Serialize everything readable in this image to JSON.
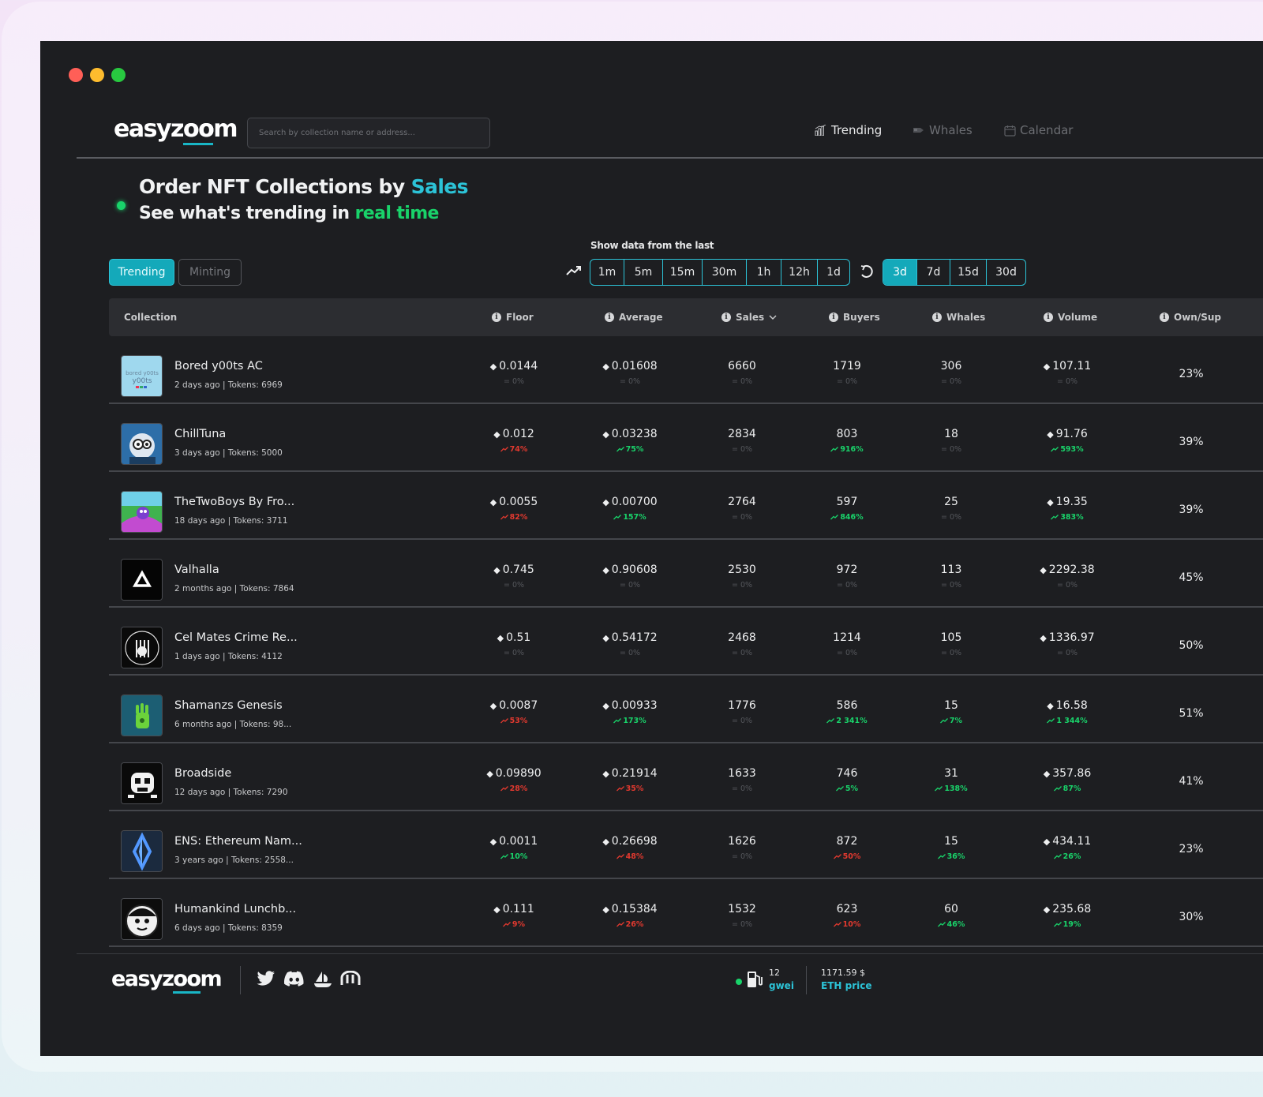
{
  "brand": {
    "name_a": "easyz",
    "name_b": "oo",
    "name_c": "m"
  },
  "search": {
    "placeholder": "Search by collection name or address..."
  },
  "nav": {
    "trending": "Trending",
    "whales": "Whales",
    "calendar": "Calendar"
  },
  "hero": {
    "title_prefix": "Order NFT Collections by ",
    "title_highlight": "Sales",
    "subtitle_prefix": "See what's trending in ",
    "subtitle_highlight": "real time"
  },
  "mode_tabs": {
    "active": "Trending",
    "inactive": "Minting"
  },
  "timeframe": {
    "label": "Show data from the last",
    "group1": [
      "1m",
      "5m",
      "15m",
      "30m",
      "1h",
      "12h",
      "1d"
    ],
    "group2": [
      "3d",
      "7d",
      "15d",
      "30d"
    ],
    "selected": "3d"
  },
  "table": {
    "headers": {
      "collection": "Collection",
      "floor": "Floor",
      "average": "Average",
      "sales": "Sales",
      "buyers": "Buyers",
      "whales": "Whales",
      "volume": "Volume",
      "own_sup": "Own/Sup"
    },
    "rows": [
      {
        "name": "Bored y00ts AC",
        "meta": "2 days ago | Tokens: 6969",
        "floor": "0.0144",
        "floor_d": "= 0%",
        "floor_t": "flat",
        "avg": "0.01608",
        "avg_d": "= 0%",
        "avg_t": "flat",
        "sales": "6660",
        "sales_d": "= 0%",
        "sales_t": "flat",
        "buyers": "1719",
        "buyers_d": "= 0%",
        "buyers_t": "flat",
        "whales": "306",
        "whales_d": "= 0%",
        "whales_t": "flat",
        "volume": "107.11",
        "volume_d": "= 0%",
        "volume_t": "flat",
        "own": "23%"
      },
      {
        "name": "ChillTuna",
        "meta": "3 days ago | Tokens: 5000",
        "floor": "0.012",
        "floor_d": "74%",
        "floor_t": "down",
        "avg": "0.03238",
        "avg_d": "75%",
        "avg_t": "up",
        "sales": "2834",
        "sales_d": "= 0%",
        "sales_t": "flat",
        "buyers": "803",
        "buyers_d": "916%",
        "buyers_t": "up",
        "whales": "18",
        "whales_d": "= 0%",
        "whales_t": "flat",
        "volume": "91.76",
        "volume_d": "593%",
        "volume_t": "up",
        "own": "39%"
      },
      {
        "name": "TheTwoBoys By Fro...",
        "meta": "18 days ago | Tokens: 3711",
        "floor": "0.0055",
        "floor_d": "82%",
        "floor_t": "down",
        "avg": "0.00700",
        "avg_d": "157%",
        "avg_t": "up",
        "sales": "2764",
        "sales_d": "= 0%",
        "sales_t": "flat",
        "buyers": "597",
        "buyers_d": "846%",
        "buyers_t": "up",
        "whales": "25",
        "whales_d": "= 0%",
        "whales_t": "flat",
        "volume": "19.35",
        "volume_d": "383%",
        "volume_t": "up",
        "own": "39%"
      },
      {
        "name": "Valhalla",
        "meta": "2 months ago | Tokens: 7864",
        "floor": "0.745",
        "floor_d": "= 0%",
        "floor_t": "flat",
        "avg": "0.90608",
        "avg_d": "= 0%",
        "avg_t": "flat",
        "sales": "2530",
        "sales_d": "= 0%",
        "sales_t": "flat",
        "buyers": "972",
        "buyers_d": "= 0%",
        "buyers_t": "flat",
        "whales": "113",
        "whales_d": "= 0%",
        "whales_t": "flat",
        "volume": "2292.38",
        "volume_d": "= 0%",
        "volume_t": "flat",
        "own": "45%"
      },
      {
        "name": "Cel Mates Crime Re...",
        "meta": "1 days ago | Tokens: 4112",
        "floor": "0.51",
        "floor_d": "= 0%",
        "floor_t": "flat",
        "avg": "0.54172",
        "avg_d": "= 0%",
        "avg_t": "flat",
        "sales": "2468",
        "sales_d": "= 0%",
        "sales_t": "flat",
        "buyers": "1214",
        "buyers_d": "= 0%",
        "buyers_t": "flat",
        "whales": "105",
        "whales_d": "= 0%",
        "whales_t": "flat",
        "volume": "1336.97",
        "volume_d": "= 0%",
        "volume_t": "flat",
        "own": "50%"
      },
      {
        "name": "Shamanzs Genesis",
        "meta": "6 months ago | Tokens: 98...",
        "floor": "0.0087",
        "floor_d": "53%",
        "floor_t": "down",
        "avg": "0.00933",
        "avg_d": "173%",
        "avg_t": "up",
        "sales": "1776",
        "sales_d": "= 0%",
        "sales_t": "flat",
        "buyers": "586",
        "buyers_d": "2 341%",
        "buyers_t": "up",
        "whales": "15",
        "whales_d": "7%",
        "whales_t": "up",
        "volume": "16.58",
        "volume_d": "1 344%",
        "volume_t": "up",
        "own": "51%"
      },
      {
        "name": "Broadside",
        "meta": "12 days ago | Tokens: 7290",
        "floor": "0.09890",
        "floor_d": "28%",
        "floor_t": "down",
        "avg": "0.21914",
        "avg_d": "35%",
        "avg_t": "down",
        "sales": "1633",
        "sales_d": "= 0%",
        "sales_t": "flat",
        "buyers": "746",
        "buyers_d": "5%",
        "buyers_t": "up",
        "whales": "31",
        "whales_d": "138%",
        "whales_t": "up",
        "volume": "357.86",
        "volume_d": "87%",
        "volume_t": "up",
        "own": "41%"
      },
      {
        "name": "ENS: Ethereum Nam...",
        "meta": "3 years ago | Tokens: 2558...",
        "floor": "0.0011",
        "floor_d": "10%",
        "floor_t": "up",
        "avg": "0.26698",
        "avg_d": "48%",
        "avg_t": "down",
        "sales": "1626",
        "sales_d": "= 0%",
        "sales_t": "flat",
        "buyers": "872",
        "buyers_d": "50%",
        "buyers_t": "down",
        "whales": "15",
        "whales_d": "36%",
        "whales_t": "up",
        "volume": "434.11",
        "volume_d": "26%",
        "volume_t": "up",
        "own": "23%"
      },
      {
        "name": "Humankind Lunchb...",
        "meta": "6 days ago | Tokens: 8359",
        "floor": "0.111",
        "floor_d": "9%",
        "floor_t": "down",
        "avg": "0.15384",
        "avg_d": "26%",
        "avg_t": "down",
        "sales": "1532",
        "sales_d": "= 0%",
        "sales_t": "flat",
        "buyers": "623",
        "buyers_d": "10%",
        "buyers_t": "down",
        "whales": "60",
        "whales_d": "46%",
        "whales_t": "up",
        "volume": "235.68",
        "volume_d": "19%",
        "volume_t": "up",
        "own": "30%"
      }
    ]
  },
  "footer": {
    "gas_value": "12",
    "gas_unit": "gwei",
    "eth_price": "1171.59 $",
    "eth_label": "ETH price",
    "social_icons": [
      "twitter-icon",
      "discord-icon",
      "opensea-icon",
      "magiceden-icon"
    ]
  },
  "colors": {
    "accent": "#14a9ba",
    "accent_light": "#2cc3d7",
    "green": "#19d36a",
    "red": "#e2392f",
    "bg": "#1d1e21"
  }
}
